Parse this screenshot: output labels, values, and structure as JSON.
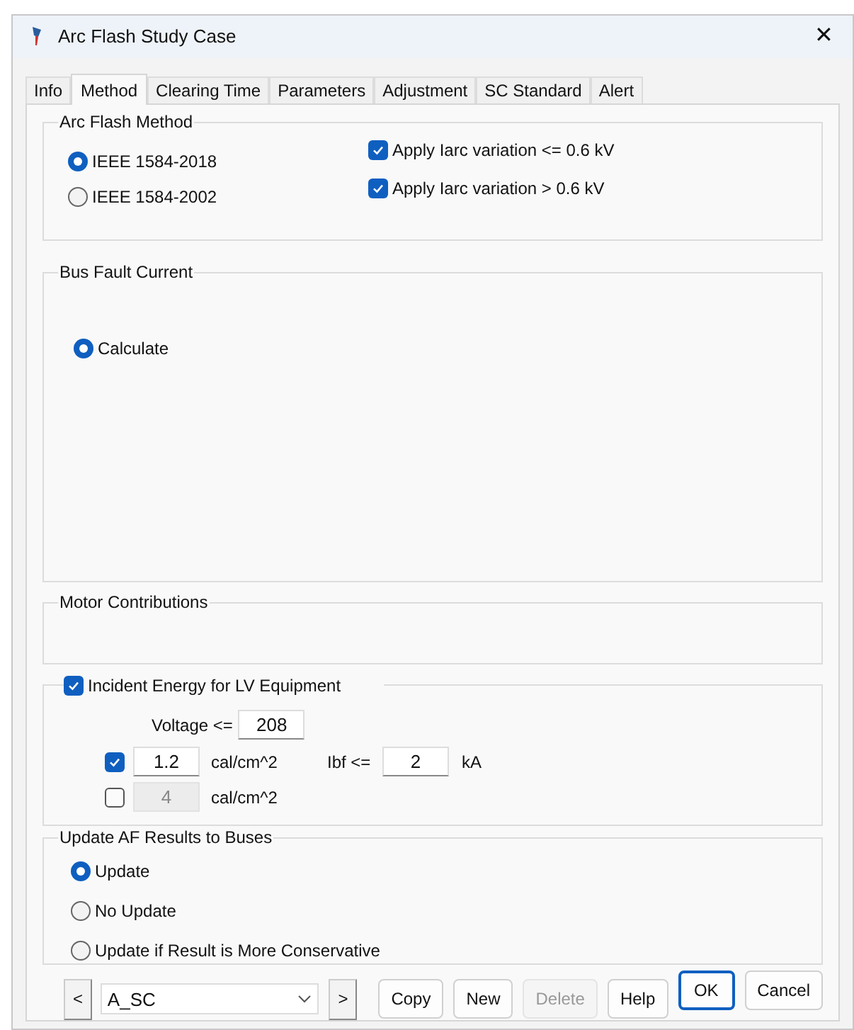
{
  "window": {
    "title": "Arc Flash Study Case",
    "close": "✕"
  },
  "tabs": [
    {
      "label": "Info",
      "selected": false
    },
    {
      "label": "Method",
      "selected": true
    },
    {
      "label": "Clearing Time",
      "selected": false
    },
    {
      "label": "Parameters",
      "selected": false
    },
    {
      "label": "Adjustment",
      "selected": false
    },
    {
      "label": "SC Standard",
      "selected": false
    },
    {
      "label": "Alert",
      "selected": false
    }
  ],
  "arc_flash_method": {
    "title": "Arc Flash Method",
    "options": [
      {
        "label": "IEEE 1584-2018",
        "selected": true
      },
      {
        "label": "IEEE 1584-2002",
        "selected": false
      }
    ],
    "checkboxes": [
      {
        "label": "Apply Iarc variation <= 0.6 kV",
        "checked": true
      },
      {
        "label": "Apply Iarc variation > 0.6 kV",
        "checked": true
      }
    ]
  },
  "bus_fault_current": {
    "title": "Bus Fault Current",
    "options": [
      {
        "label": "Calculate",
        "selected": true
      }
    ]
  },
  "motor_contributions": {
    "title": "Motor Contributions"
  },
  "incident_energy": {
    "label": "Incident Energy for LV Equipment",
    "checked": true,
    "voltage_label": "Voltage <=",
    "voltage_value": "208",
    "rows": [
      {
        "checked": true,
        "value": "1.2",
        "disabled": false,
        "unit": "cal/cm^2",
        "ibf_label": "Ibf <=",
        "ibf_value": "2",
        "ibf_unit": "kA"
      },
      {
        "checked": false,
        "value": "4",
        "disabled": true,
        "unit": "cal/cm^2"
      }
    ]
  },
  "update_af": {
    "title": "Update AF Results to Buses",
    "options": [
      {
        "label": "Update",
        "selected": true
      },
      {
        "label": "No Update",
        "selected": false
      },
      {
        "label": "Update if Result is More Conservative",
        "selected": false
      }
    ]
  },
  "footer": {
    "prev": "<",
    "combo_value": "A_SC",
    "next": ">",
    "buttons": [
      {
        "label": "Copy",
        "disabled": false,
        "default": false
      },
      {
        "label": "New",
        "disabled": false,
        "default": false
      },
      {
        "label": "Delete",
        "disabled": true,
        "default": false
      },
      {
        "label": "Help",
        "disabled": false,
        "default": false
      },
      {
        "label": "OK",
        "disabled": false,
        "default": true
      },
      {
        "label": "Cancel",
        "disabled": false,
        "default": false
      }
    ]
  }
}
